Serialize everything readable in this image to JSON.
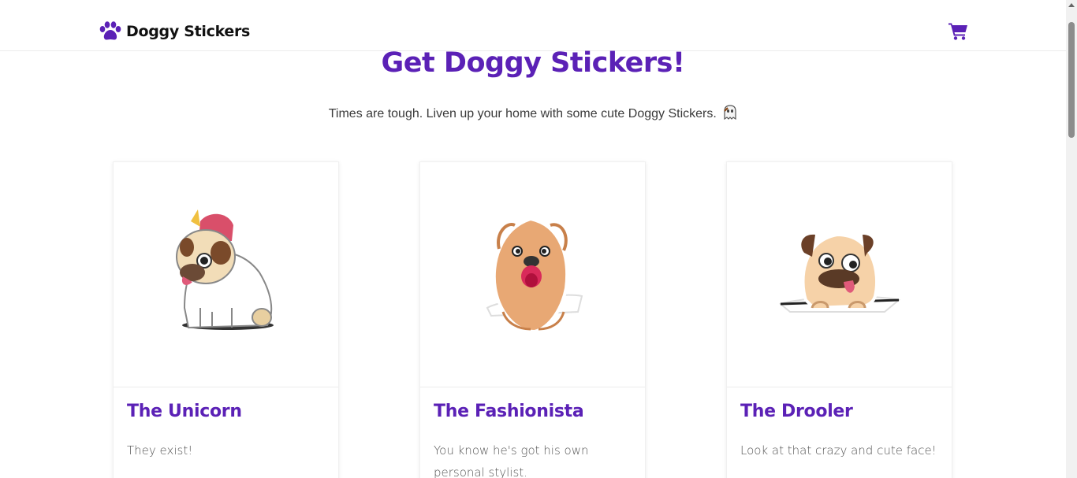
{
  "nav": {
    "brand": "Doggy Stickers",
    "brand_icon": "paw-icon",
    "cart_icon": "shopping-cart-icon",
    "accent_color": "#5b21b6"
  },
  "hero": {
    "title": "Get Doggy Stickers!",
    "subtitle": "Times are tough. Liven up your home with some cute Doggy Stickers.",
    "subtitle_icon": "ghost-emoji"
  },
  "products": [
    {
      "name": "The Unicorn",
      "description": "They exist!",
      "image": "pug-unicorn-sticker"
    },
    {
      "name": "The Fashionista",
      "description": "You know he's got his own personal stylist.",
      "image": "fluffy-dog-sticker"
    },
    {
      "name": "The Drooler",
      "description": "Look at that crazy and cute face!",
      "image": "pug-drooler-sticker"
    }
  ]
}
